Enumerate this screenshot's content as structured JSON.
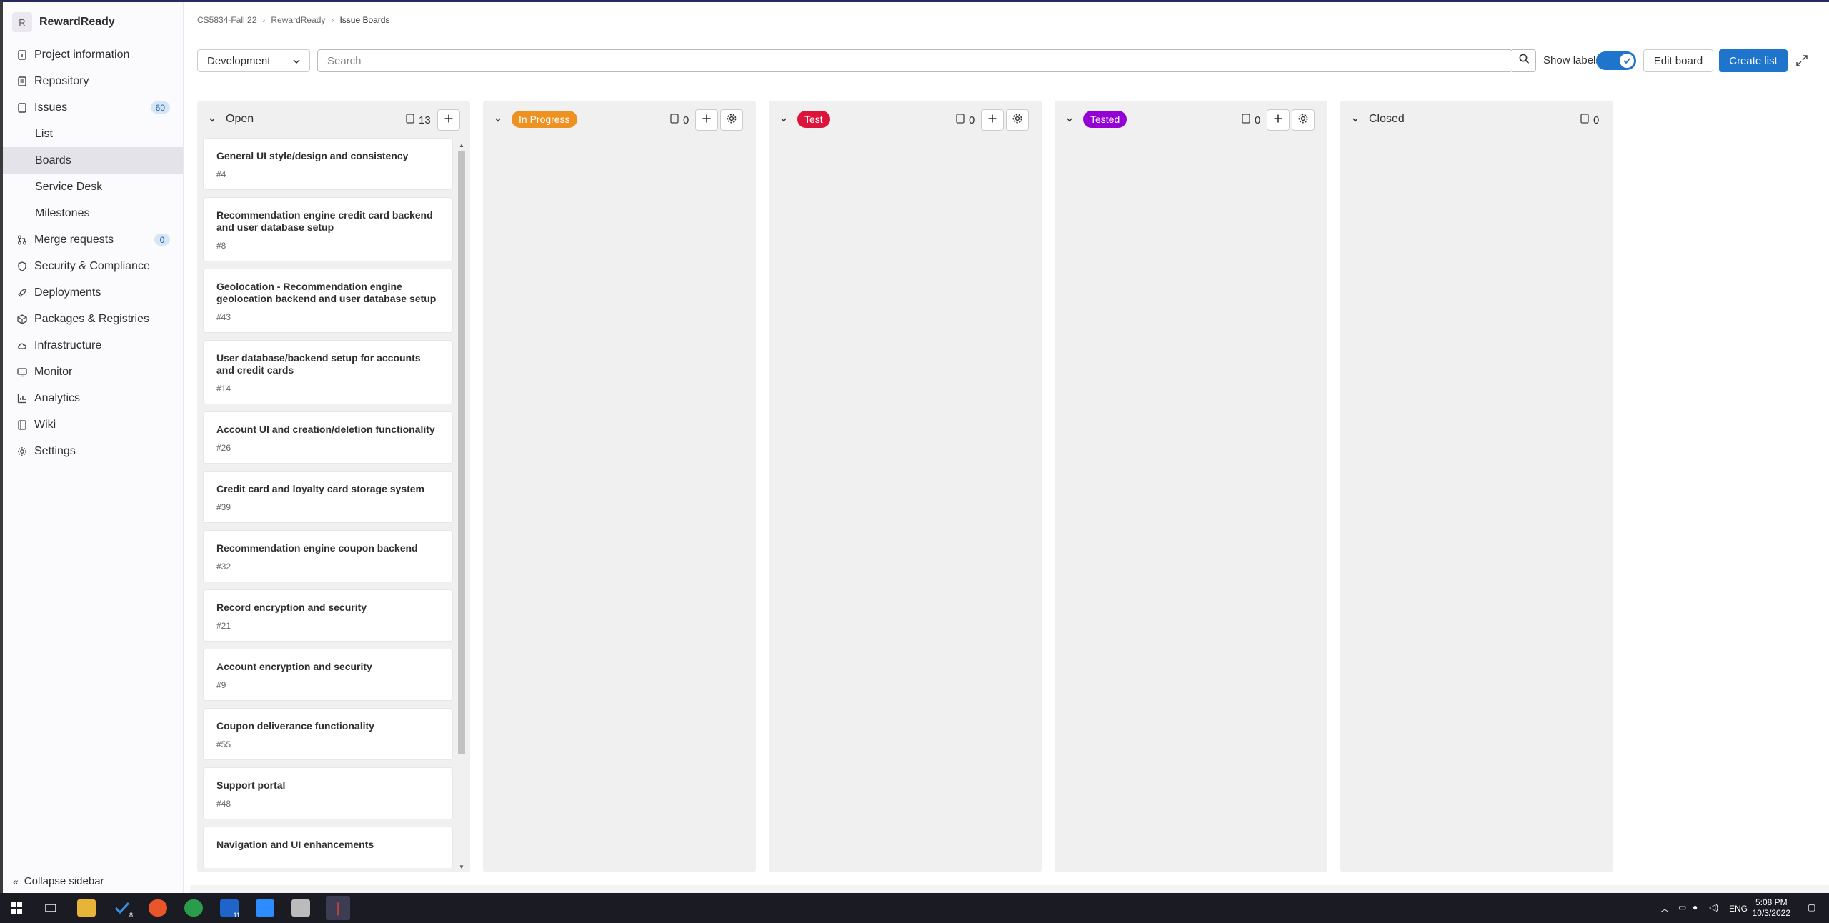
{
  "project": {
    "avatar_letter": "R",
    "name": "RewardReady"
  },
  "sidebar": {
    "items": [
      {
        "label": "Project information",
        "icon": "info-doc-icon"
      },
      {
        "label": "Repository",
        "icon": "doc-icon"
      },
      {
        "label": "Issues",
        "icon": "issues-icon",
        "badge": "60"
      },
      {
        "label": "List",
        "sub": true
      },
      {
        "label": "Boards",
        "sub": true,
        "active": true
      },
      {
        "label": "Service Desk",
        "sub": true
      },
      {
        "label": "Milestones",
        "sub": true
      },
      {
        "label": "Merge requests",
        "icon": "merge-request-icon",
        "badge": "0"
      },
      {
        "label": "Security & Compliance",
        "icon": "shield-icon"
      },
      {
        "label": "Deployments",
        "icon": "rocket-icon"
      },
      {
        "label": "Packages & Registries",
        "icon": "package-icon"
      },
      {
        "label": "Infrastructure",
        "icon": "cloud-icon"
      },
      {
        "label": "Monitor",
        "icon": "monitor-icon"
      },
      {
        "label": "Analytics",
        "icon": "chart-icon"
      },
      {
        "label": "Wiki",
        "icon": "book-icon"
      },
      {
        "label": "Settings",
        "icon": "gear-icon"
      }
    ],
    "collapse_label": "Collapse sidebar"
  },
  "breadcrumb": [
    "CS5834-Fall 22",
    "RewardReady",
    "Issue Boards"
  ],
  "toolbar": {
    "board_select": "Development",
    "search_placeholder": "Search",
    "show_labels": "Show labels",
    "show_labels_on": true,
    "edit_board": "Edit board",
    "create_list": "Create list"
  },
  "colors": {
    "accent": "#1f75cb",
    "in_progress": "#ed9121",
    "test": "#dc143c",
    "tested": "#9400d3"
  },
  "lists": [
    {
      "title": "Open",
      "count": "13",
      "cards": [
        {
          "title": "General UI style/design and consistency",
          "num": "#4"
        },
        {
          "title": "Recommendation engine credit card backend and user database setup",
          "num": "#8"
        },
        {
          "title": "Geolocation - Recommendation engine geolocation backend and user database setup",
          "num": "#43"
        },
        {
          "title": "User database/backend setup for accounts and credit cards",
          "num": "#14"
        },
        {
          "title": "Account UI and creation/deletion functionality",
          "num": "#26"
        },
        {
          "title": "Credit card and loyalty card storage system",
          "num": "#39"
        },
        {
          "title": "Recommendation engine coupon backend",
          "num": "#32"
        },
        {
          "title": "Record encryption and security",
          "num": "#21"
        },
        {
          "title": "Account encryption and security",
          "num": "#9"
        },
        {
          "title": "Coupon deliverance functionality",
          "num": "#55"
        },
        {
          "title": "Support portal",
          "num": "#48"
        },
        {
          "title": "Navigation and UI enhancements",
          "num": ""
        }
      ]
    },
    {
      "title": "In Progress",
      "count": "0"
    },
    {
      "title": "Test",
      "count": "0"
    },
    {
      "title": "Tested",
      "count": "0"
    },
    {
      "title": "Closed",
      "count": "0"
    }
  ],
  "taskbar": {
    "language": "ENG",
    "time": "5:08 PM",
    "date": "10/3/2022",
    "todo_badge": "8",
    "app_badge": "11"
  }
}
